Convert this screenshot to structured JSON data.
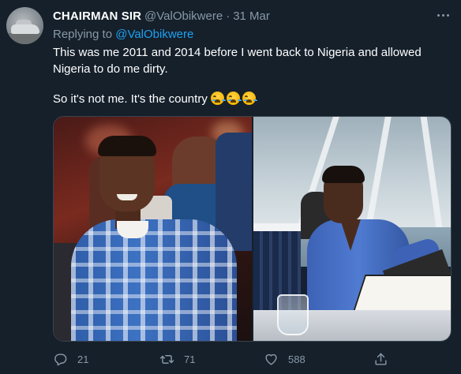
{
  "tweet": {
    "display_name": "CHAIRMAN SIR",
    "handle": "@ValObikwere",
    "separator": "·",
    "date": "31 Mar",
    "replying_prefix": "Replying to ",
    "replying_to": "@ValObikwere",
    "text_line1": "This was me 2011 and 2014 before I went back to Nigeria and allowed",
    "text_line2": "Nigeria to do me dirty.",
    "text_line3": "So it's not me. It's the country",
    "emoji": [
      "loudly-crying-face",
      "loudly-crying-face",
      "loudly-crying-face"
    ],
    "media": [
      {
        "icon": "photo-young-man-plaid-shirt"
      },
      {
        "icon": "photo-man-restaurant-reading-menu"
      }
    ]
  },
  "actions": {
    "reply": {
      "icon": "reply-icon",
      "count": "21"
    },
    "retweet": {
      "icon": "retweet-icon",
      "count": "71"
    },
    "like": {
      "icon": "heart-icon",
      "count": "588"
    },
    "share": {
      "icon": "share-icon",
      "count": ""
    }
  },
  "colors": {
    "background": "#15202b",
    "secondary_text": "#8899a6",
    "link": "#1da1f2",
    "primary_text": "#ffffff",
    "border": "#38444d"
  }
}
